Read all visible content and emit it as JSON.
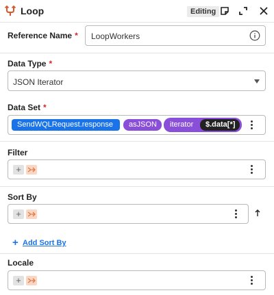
{
  "header": {
    "title": "Loop",
    "status_badge": "Editing"
  },
  "reference_name": {
    "label": "Reference Name",
    "required_mark": "*",
    "value": "LoopWorkers"
  },
  "data_type": {
    "label": "Data Type",
    "required_mark": "*",
    "value": "JSON Iterator"
  },
  "data_set": {
    "label": "Data Set",
    "required_mark": "*",
    "tokens": [
      "SendWQLRequest.response",
      "asJSON",
      "iterator",
      "$.data[*]"
    ]
  },
  "filter": {
    "label": "Filter"
  },
  "sort_by": {
    "label": "Sort By"
  },
  "add_sort_by": {
    "label": "Add Sort By"
  },
  "locale": {
    "label": "Locale"
  },
  "mini_buttons": {
    "plus": "+"
  },
  "colors": {
    "accent": "#1a73e8",
    "required": "#d9232f",
    "loop_icon": "#d9582b",
    "function_pill": "#8a4fd8",
    "path_pill": "#222222",
    "variable_button": "#f9d7c4"
  },
  "icons": [
    "loop-icon",
    "note-icon",
    "expand-icon",
    "close-icon",
    "info-icon",
    "chevron-down-icon",
    "kebab-menu-icon",
    "plus-icon",
    "variable-icon",
    "arrow-up-icon"
  ]
}
